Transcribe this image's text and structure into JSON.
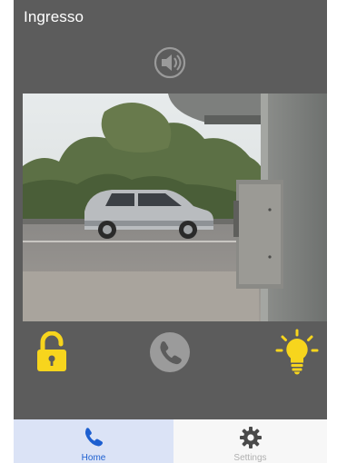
{
  "header": {
    "title": "Ingresso"
  },
  "controls": {
    "speaker_icon": "speaker-icon",
    "unlock_icon": "unlock-icon",
    "call_icon": "phone-icon",
    "light_icon": "lightbulb-icon"
  },
  "tabs": [
    {
      "label": "Home",
      "icon": "phone-icon",
      "active": true
    },
    {
      "label": "Settings",
      "icon": "gear-icon",
      "active": false
    }
  ],
  "colors": {
    "accent_yellow": "#f7d51d",
    "active_tab_blue": "#1d5fd0",
    "background": "#5c5c5c"
  }
}
